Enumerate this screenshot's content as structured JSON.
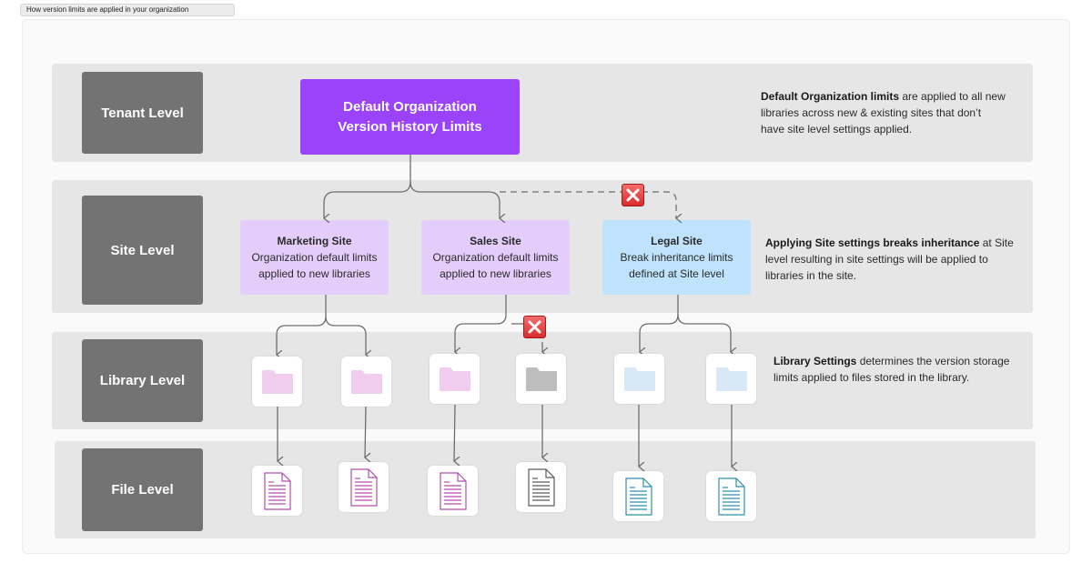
{
  "caption": "How version limits are applied in your organization",
  "levels": [
    {
      "label": "Tenant Level"
    },
    {
      "label": "Site Level"
    },
    {
      "label": "Library Level"
    },
    {
      "label": "File Level"
    }
  ],
  "tenant": {
    "line1": "Default Organization",
    "line2": "Version History Limits"
  },
  "sites": [
    {
      "title": "Marketing Site",
      "line1": "Organization default limits",
      "line2": "applied to new libraries",
      "color": "#e4cdfb"
    },
    {
      "title": "Sales Site",
      "line1": "Organization default limits",
      "line2": "applied to new libraries",
      "color": "#e4cdfb"
    },
    {
      "title": "Legal Site",
      "line1": "Break inheritance limits",
      "line2": "defined at Site level",
      "color": "#bfe3fd"
    }
  ],
  "descriptions": {
    "tenant": {
      "bold": "Default Organization limits",
      "rest": " are applied to all new libraries across new & existing sites that don’t have site level settings applied."
    },
    "site": {
      "bold": "Applying Site settings breaks inheritance",
      "rest": " at Site level resulting in site settings will be applied to libraries in the site."
    },
    "library": {
      "bold": "Library Settings",
      "rest": " determines the version storage limits applied to files stored in the library."
    }
  },
  "libraries": [
    {
      "icon": "folder-icon",
      "color": "#f0ccee"
    },
    {
      "icon": "folder-icon",
      "color": "#f0ccee"
    },
    {
      "icon": "folder-icon",
      "color": "#f0ccee"
    },
    {
      "icon": "folder-icon",
      "color": "#bdbdbd"
    },
    {
      "icon": "folder-icon",
      "color": "#d8e8f7"
    },
    {
      "icon": "folder-icon",
      "color": "#d8e8f7"
    }
  ],
  "files": [
    {
      "icon": "document-icon",
      "color": "#b04fb0"
    },
    {
      "icon": "document-icon",
      "color": "#b04fb0"
    },
    {
      "icon": "document-icon",
      "color": "#b04fb0"
    },
    {
      "icon": "document-icon",
      "color": "#5a5a5a"
    },
    {
      "icon": "document-icon",
      "color": "#2f8fb0"
    },
    {
      "icon": "document-icon",
      "color": "#2f8fb0"
    }
  ],
  "blocked_markers": [
    {
      "icon": "blocked-x-icon",
      "between": "Tenant → Legal Site"
    },
    {
      "icon": "blocked-x-icon",
      "between": "Sales Site → grey library"
    }
  ],
  "colors": {
    "tenant_accent": "#9b42fb",
    "level_box": "#737373",
    "band": "#e6e6e6",
    "connector": "#6e6e6e",
    "blocked": "#e23b3b"
  }
}
